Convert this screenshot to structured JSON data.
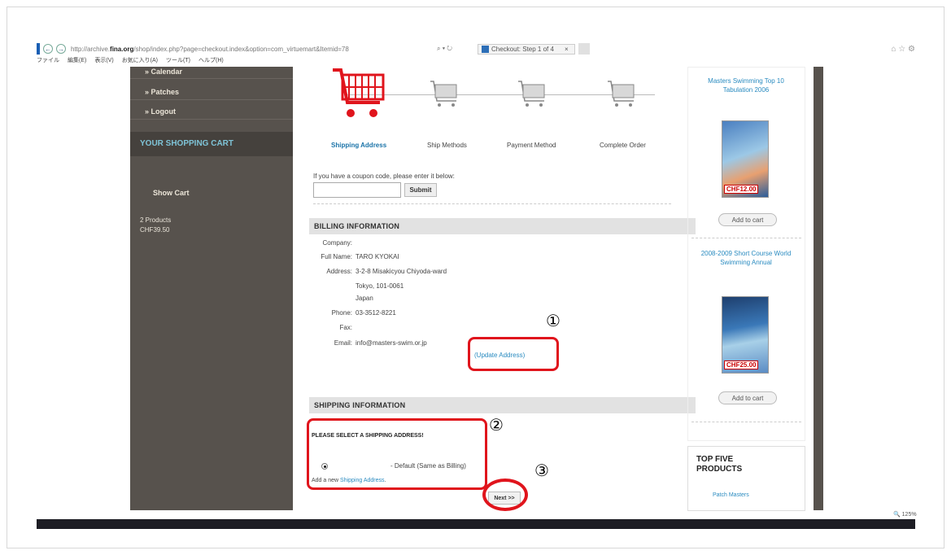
{
  "browser": {
    "url_prefix": "http://archive.",
    "url_domain": "fina.org",
    "url_rest": "/shop/index.php?page=checkout.index&option=com_virtuemart&Itemid=78",
    "search_refresh": "⌕ ▾ ↻",
    "tab_title": "Checkout: Step 1 of 4",
    "tab_close": "×",
    "right_icons": "⌂ ☆ ⚙",
    "zoom_level": "🔍 125%"
  },
  "menu": [
    "ファイル",
    "編集(E)",
    "表示(V)",
    "お気に入り(A)",
    "ツール(T)",
    "ヘルプ(H)"
  ],
  "left_panel": {
    "items": [
      "» Calendar",
      "» Patches",
      "» Logout"
    ],
    "cart_header": "YOUR SHOPPING CART",
    "show_cart": "Show Cart",
    "cart_products": "2 Products",
    "cart_total": "CHF39.50"
  },
  "steps": {
    "labels": [
      "Shipping Address",
      "Ship Methods",
      "Payment Method",
      "Complete Order"
    ],
    "active_index": 0
  },
  "coupon": {
    "prompt": "If you have a coupon code, please enter it below:",
    "input_value": "",
    "submit_label": "Submit"
  },
  "billing": {
    "heading": "BILLING INFORMATION",
    "company_label": "Company:",
    "company_value": "",
    "fullname_label": "Full Name:",
    "fullname_value": "TARO KYOKAI",
    "address_label": "Address:",
    "address_line1": "3-2-8 Misakicyou Chiyoda-ward",
    "address_line2": "Tokyo, 101-0061",
    "address_line3": "Japan",
    "phone_label": "Phone:",
    "phone_value": "03-3512-8221",
    "fax_label": "Fax:",
    "fax_value": "",
    "email_label": "Email:",
    "email_value": "info@masters-swim.or.jp",
    "update_link": "(Update Address)"
  },
  "shipping": {
    "heading": "SHIPPING INFORMATION",
    "select_heading": "PLEASE SELECT A SHIPPING ADDRESS!",
    "default_option": "- Default (Same as Billing)",
    "add_new_prefix": "Add a new ",
    "add_new_link": "Shipping Address",
    "add_new_suffix": ".",
    "next_label": "Next >>"
  },
  "annotations": {
    "marker1": "①",
    "marker2": "②",
    "marker3": "③",
    "highlight_color": "#e0141c"
  },
  "right_panel": {
    "product1_title": "Masters Swimming Top 10 Tabulation 2006",
    "product1_price": "CHF12.00",
    "add_to_cart": "Add to cart",
    "product2_title": "2008-2009 Short Course World Swimming Annual",
    "product2_price": "CHF25.00",
    "top_five_title": "TOP FIVE PRODUCTS",
    "top_five_link": "Patch Masters"
  },
  "colors": {
    "sidebar": "#57524d",
    "link": "#2a8bc0",
    "active_cart": "#e0141c"
  }
}
